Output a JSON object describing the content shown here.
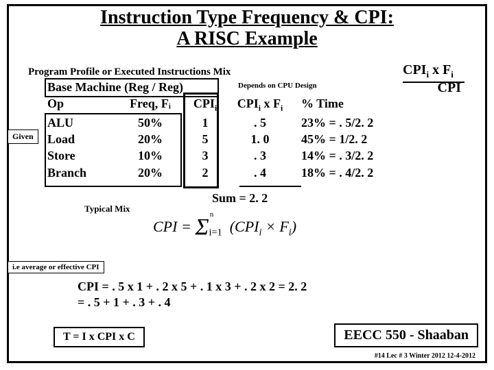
{
  "title_line1": "Instruction Type Frequency & CPI:",
  "title_line2": "A RISC Example",
  "profile_label": "Program Profile or Executed Instructions Mix",
  "top_cpi_fi": "CPIᵢ x Fᵢ",
  "cpi_word": "CPI",
  "depends": "Depends on CPU Design",
  "base_header": "Base Machine (Reg / Reg)",
  "hdr": {
    "op": "Op",
    "freq": "Freq, Fᵢ",
    "cpii": "CPIᵢ",
    "cpif": "CPIᵢ x Fᵢ",
    "time": "% Time"
  },
  "rows": [
    {
      "op": "ALU",
      "freq": "50%",
      "cpii": "1",
      "cpif": ". 5",
      "time": "23% =  . 5/2. 2"
    },
    {
      "op": "Load",
      "freq": "20%",
      "cpii": "5",
      "cpif": "1. 0",
      "time": "45% =  1/2. 2"
    },
    {
      "op": "Store",
      "freq": "10%",
      "cpii": "3",
      "cpif": ". 3",
      "time": "14% =  . 3/2. 2"
    },
    {
      "op": "Branch",
      "freq": "20%",
      "cpii": "2",
      "cpif": ". 4",
      "time": "18% =  . 4/2. 2"
    }
  ],
  "given": "Given",
  "sum": "Sum  =  2. 2",
  "typical": "Typical Mix",
  "formula": "CPI = Σ (CPIᵢ × Fᵢ)",
  "avg": "i.e average or effective CPI",
  "calc1": "CPI   =  . 5 x 1 +  . 2 x 5  + . 1 x 3 +  . 2 x 2   = 2. 2",
  "calc2": "         =   . 5     +       1     +   . 3    +    . 4",
  "tic": "T =   I   x  CPI   x C",
  "course": "EECC 550 - Shaaban",
  "footer_lec": "#14  Lec # 3    Winter 2012   12-4-2012",
  "chart_data": {
    "type": "table",
    "title": "Instruction Type Frequency & CPI: A RISC Example",
    "columns": [
      "Op",
      "Freq Fi",
      "CPIi",
      "CPIi×Fi",
      "% Time"
    ],
    "rows": [
      [
        "ALU",
        0.5,
        1,
        0.5,
        0.23
      ],
      [
        "Load",
        0.2,
        5,
        1.0,
        0.45
      ],
      [
        "Store",
        0.1,
        3,
        0.3,
        0.14
      ],
      [
        "Branch",
        0.2,
        2,
        0.4,
        0.18
      ]
    ],
    "sum_cpi": 2.2,
    "formula": "CPI = sum(CPI_i * F_i)",
    "time_formula": "T = I * CPI * C"
  }
}
